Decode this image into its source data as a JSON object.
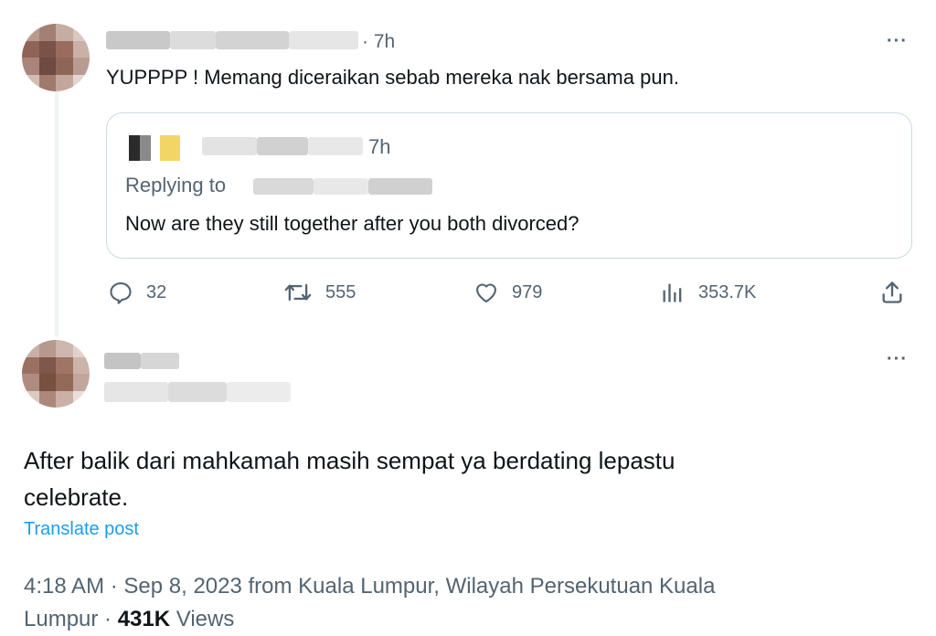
{
  "tweet1": {
    "time": "· 7h",
    "text": "YUPPPP ! Memang diceraikan sebab mereka nak bersama pun.",
    "more_label": "···",
    "quote": {
      "time": "7h",
      "replying_to_label": "Replying to",
      "text": "Now are they still together after you both divorced?"
    },
    "actions": {
      "replies": "32",
      "reposts": "555",
      "likes": "979",
      "views": "353.7K"
    }
  },
  "tweet2": {
    "more_label": "···",
    "text_line1": "After balik dari mahkamah  masih sempat ya berdating lepastu",
    "text_line2": "celebrate.",
    "translate_label": "Translate post",
    "meta_line1": "4:18 AM · Sep 8, 2023 from Kuala Lumpur, Wilayah Persekutuan Kuala",
    "meta_line2_prefix": "Lumpur · ",
    "views_count": "431K",
    "views_label": " Views"
  },
  "colors": {
    "text": "#0f1419",
    "muted": "#536471",
    "link": "#1d9bf0",
    "border": "#cfd9de"
  },
  "icons": [
    "reply-icon",
    "repost-icon",
    "like-icon",
    "views-icon",
    "share-icon",
    "more-icon"
  ]
}
